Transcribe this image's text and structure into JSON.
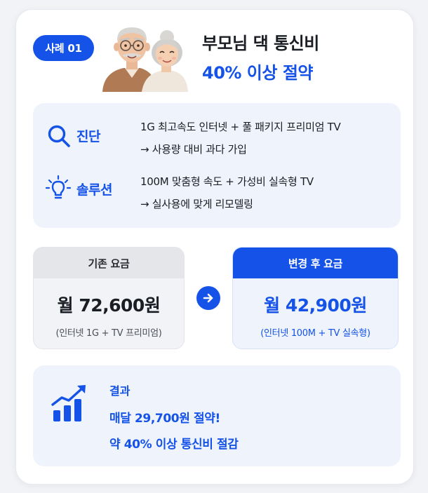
{
  "header": {
    "badge": "사례 01",
    "title_line1": "부모님 댁 통신비",
    "title_line2": "40% 이상 절약"
  },
  "diagnosis": {
    "label": "진단",
    "icon": "magnifier-icon",
    "lines": [
      "1G 최고속도 인터넷 + 풀 패키지 프리미엄 TV",
      "→ 사용량 대비 과다 가입"
    ]
  },
  "solution": {
    "label": "솔루션",
    "icon": "lightbulb-icon",
    "lines": [
      "100M 맞춤형 속도 + 가성비 실속형 TV",
      "→ 실사용에 맞게 리모델링"
    ]
  },
  "before": {
    "header": "기존 요금",
    "amount": "월 72,600원",
    "detail": "(인터넷 1G + TV 프리미엄)"
  },
  "after": {
    "header": "변경 후 요금",
    "amount": "월 42,900원",
    "detail": "(인터넷 100M + TV 실속형)"
  },
  "result": {
    "label": "결과",
    "icon": "growth-chart-icon",
    "lines": [
      "매달 29,700원 절약!",
      "약 40% 이상 통신비 절감"
    ]
  },
  "colors": {
    "accent": "#1452e8",
    "panel": "#eef3fc",
    "text": "#1a1d24"
  }
}
